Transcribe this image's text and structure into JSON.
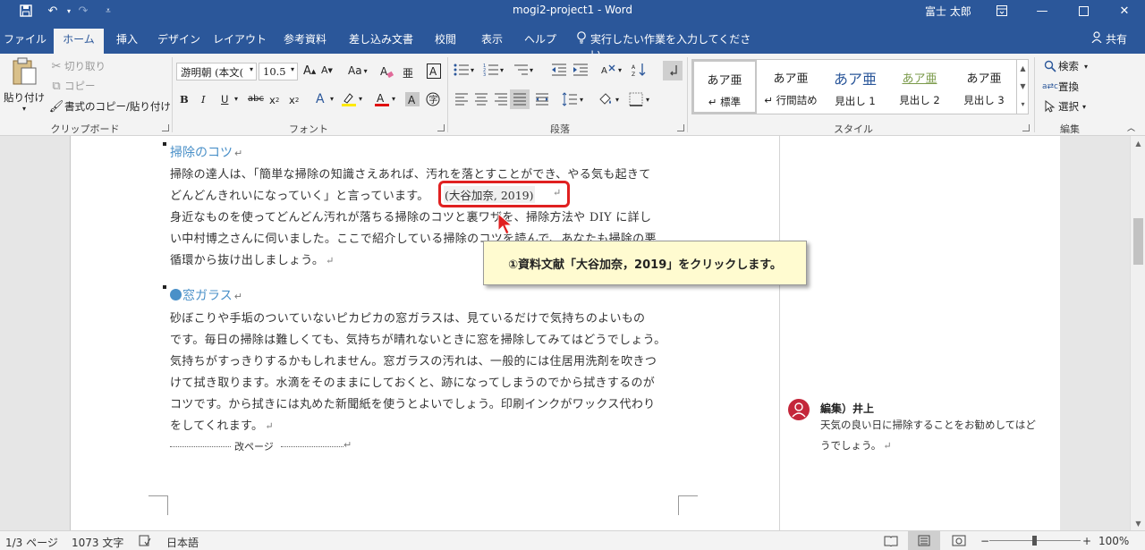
{
  "window": {
    "title": "mogi2-project1  -  Word",
    "user": "富士 太郎",
    "share": "共有"
  },
  "tabs": [
    {
      "label": "ファイル",
      "active": false
    },
    {
      "label": "ホーム",
      "active": true
    },
    {
      "label": "挿入",
      "active": false
    },
    {
      "label": "デザイン",
      "active": false
    },
    {
      "label": "レイアウト",
      "active": false
    },
    {
      "label": "参考資料",
      "active": false
    },
    {
      "label": "差し込み文書",
      "active": false
    },
    {
      "label": "校閲",
      "active": false
    },
    {
      "label": "表示",
      "active": false
    },
    {
      "label": "ヘルプ",
      "active": false
    }
  ],
  "tellme": "実行したい作業を入力してください",
  "ribbon": {
    "clipboard": {
      "paste": "貼り付け",
      "cut": "切り取り",
      "copy": "コピー",
      "format_painter": "書式のコピー/貼り付け",
      "label": "クリップボード"
    },
    "font": {
      "font_name": "游明朝 (本文(",
      "font_size": "10.5",
      "label": "フォント",
      "aa": "Aa"
    },
    "paragraph": {
      "label": "段落"
    },
    "styles": {
      "label": "スタイル",
      "items": [
        {
          "preview": "あア亜",
          "name": "↵ 標準"
        },
        {
          "preview": "あア亜",
          "name": "↵ 行間詰め"
        },
        {
          "preview": "あア亜",
          "name": "見出し 1"
        },
        {
          "preview": "あア亜",
          "name": "見出し 2"
        },
        {
          "preview": "あア亜",
          "name": "見出し 3"
        }
      ]
    },
    "editing": {
      "find": "検索",
      "replace": "置換",
      "select": "選択",
      "label": "編集"
    }
  },
  "document": {
    "heading1": "掃除のコツ",
    "para1": [
      "掃除の達人は、「簡単な掃除の知識さえあれば、汚れを落とすことができ、やる気も起きて",
      "どんどんきれいになっていく」と言っています。"
    ],
    "citation": "(大谷加奈, 2019)",
    "para2": [
      "身近なものを使ってどんどん汚れが落ちる掃除のコツと裏ワザを、掃除方法や DIY に詳し",
      "い中村博之さんに伺いました。ここで紹介している掃除のコツを読んで、あなたも掃除の悪",
      "循環から抜け出しましょう。"
    ],
    "heading2": "窓ガラス",
    "para3": [
      "砂ぼこりや手垢のついていないピカピカの窓ガラスは、見ているだけで気持ちのよいもの",
      "です。毎日の掃除は難しくても、気持ちが晴れないときに窓を掃除してみてはどうでしょう。",
      "気持ちがすっきりするかもしれません。窓ガラスの汚れは、一般的には住居用洗剤を吹きつ",
      "けて拭き取ります。水滴をそのままにしておくと、跡になってしまうのでから拭きするのが",
      "コツです。から拭きには丸めた新聞紙を使うとよいでしょう。印刷インクがワックス代わり",
      "をしてくれます。"
    ],
    "page_break": "改ページ"
  },
  "callout": "①資料文献「大谷加奈，2019」をクリックします。",
  "comment": {
    "author": "編集）井上",
    "lines": [
      "天気の良い日に掃除することをお勧めしてはど",
      "うでしょう。"
    ]
  },
  "status": {
    "page": "1/3 ページ",
    "words": "1073 文字",
    "language": "日本語",
    "zoom": "100%"
  },
  "colors": {
    "title_bar": "#2b579a",
    "heading": "#4a90c8",
    "highlight_box": "#e02020",
    "callout_bg": "#fffbd0",
    "avatar": "#c4263a"
  }
}
